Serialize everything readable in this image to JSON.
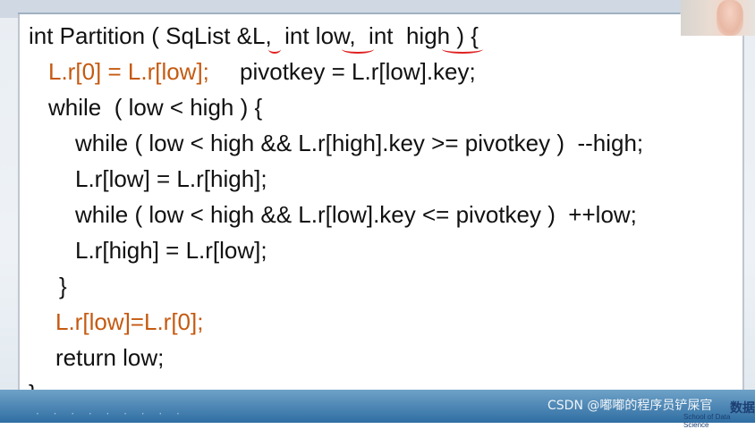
{
  "code": {
    "line1": "int Partition ( SqList &L,  int low,  int  high ) {",
    "line2a": "L.r[0] = L.r[low];",
    "line2b": "pivotkey = L.r[low].key;",
    "line3": "while  ( low < high ) {",
    "line4": "while ( low < high && L.r[high].key >= pivotkey )  --high;",
    "line5": "L.r[low] = L.r[high];",
    "line6": "while ( low < high && L.r[low].key <= pivotkey )  ++low;",
    "line7": "L.r[high] = L.r[low];",
    "line8": "}",
    "line9": "L.r[low]=L.r[0];",
    "line10": "return low;",
    "line11": "}"
  },
  "watermark": "CSDN @嘟嘟的程序员铲屎官",
  "logo": {
    "line1": "数据",
    "line2": "School of Data Science"
  },
  "colors": {
    "highlight": "#c55a11",
    "text": "#111111",
    "underline": "#e02020",
    "banner": "#2f6ea3"
  }
}
